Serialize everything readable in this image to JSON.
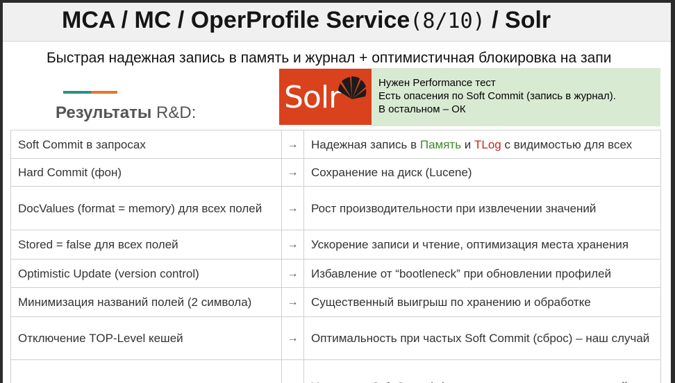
{
  "title": {
    "prefix": "MCA / MC / OperProfile Service",
    "mono": "(8/10)",
    "suffix": " / Solr"
  },
  "subtitle": "Быстрая надежная запись в память и журнал + оптимистичная блокировка на запи",
  "heading": {
    "bold": "Результаты",
    "rest": " R&D:"
  },
  "logo": {
    "text": "Solr",
    "icon": "solr-sun-icon",
    "bg": "#d9421d"
  },
  "note": {
    "lines": [
      "Нужен Performance тест",
      "Есть опасения по Soft Commit (запись в журнал).",
      "В остальном – ОК"
    ],
    "bg": "#d9ead3"
  },
  "arrow": "→",
  "rows": [
    {
      "feature": "Soft Commit в запросах",
      "result_prefix": "Надежная запись в ",
      "result_green": "Память",
      "result_mid": " и ",
      "result_red": "TLog",
      "result_suffix": " с видимостью для всех"
    },
    {
      "feature": "Hard Commit (фон)",
      "result": "Сохранение на диск (Lucene)"
    },
    {
      "feature": "DocValues (format = memory) для всех полей",
      "result": "Рост производительности при извлечении значений"
    },
    {
      "feature": "Stored = false для всех полей",
      "result": "Ускорение записи и чтение, оптимизация места хранения"
    },
    {
      "feature": "Optimistic Update (version control)",
      "result": "Избавление от “bootleneck” при обновлении профилей"
    },
    {
      "feature": "Минимизация названий полей (2 символа)",
      "result": "Существенный выигрыш по хранению и обработке"
    },
    {
      "feature": "Отключение TOP-Level кешей",
      "result": "Оптимальность при частых Soft Commit (сброс) – наш случай"
    },
    {
      "feature": "",
      "result": "Ускорение Soft Commit (отсутствие синхронных операций"
    }
  ],
  "colors": {
    "green": "#3c8a2e",
    "red": "#c1281c",
    "accent_teal": "#2f8f88",
    "accent_orange": "#e2762a"
  }
}
